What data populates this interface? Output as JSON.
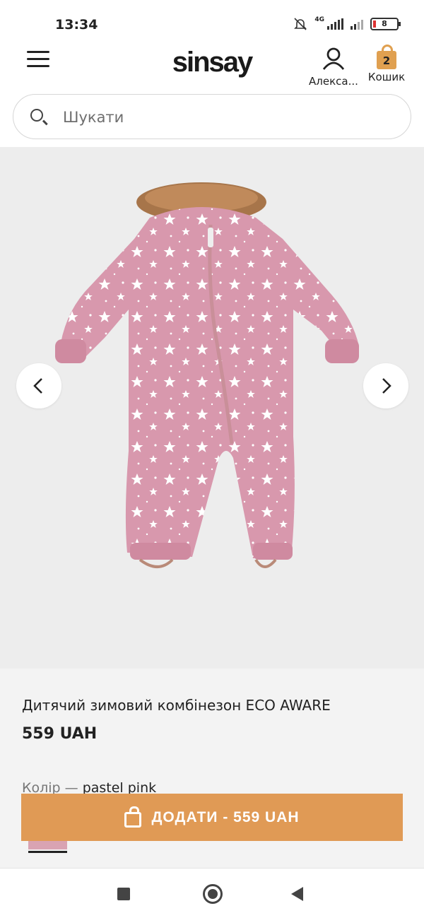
{
  "status": {
    "time": "13:34",
    "network": "4G",
    "battery": "8"
  },
  "header": {
    "logo": "sinsay",
    "account_label": "Алекса...",
    "cart_label": "Кошик",
    "cart_count": "2"
  },
  "search": {
    "placeholder": "Шукати"
  },
  "gallery": {
    "image": "pink-star-snowsuit"
  },
  "product": {
    "title": "Дитячий зимовий комбінезон ECO AWARE",
    "price": "559 UAH",
    "color_label": "Колір — ",
    "color_value": "pastel pink"
  },
  "cta": {
    "label": "ДОДАТИ - 559 UAH"
  },
  "colors": {
    "accent": "#e09a55",
    "swatch": "#d9a3b2",
    "gallery_bg": "#ededed"
  }
}
